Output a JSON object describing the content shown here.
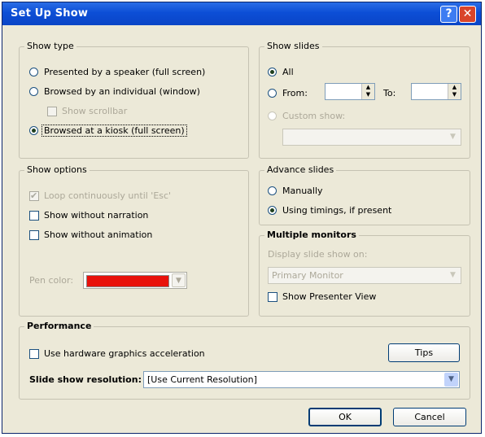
{
  "window": {
    "title": "Set Up Show",
    "help_glyph": "?",
    "close_glyph": "✕"
  },
  "show_type": {
    "title": "Show type",
    "options": [
      {
        "label": "Presented by a speaker (full screen)",
        "checked": false
      },
      {
        "label": "Browsed by an individual (window)",
        "checked": false
      },
      {
        "label": "Browsed at a kiosk (full screen)",
        "checked": true
      }
    ],
    "show_scrollbar_label": "Show scrollbar"
  },
  "show_slides": {
    "title": "Show slides",
    "all_label": "All",
    "from_label": "From:",
    "to_label": "To:",
    "custom_label": "Custom show:",
    "from_value": "",
    "to_value": ""
  },
  "show_options": {
    "title": "Show options",
    "loop_label": "Loop continuously until 'Esc'",
    "no_narration_label": "Show without narration",
    "no_animation_label": "Show without animation",
    "pen_color_label": "Pen color:",
    "pen_color": "#e8120c"
  },
  "advance_slides": {
    "title": "Advance slides",
    "manual_label": "Manually",
    "timings_label": "Using timings, if present"
  },
  "multiple_monitors": {
    "title": "Multiple monitors",
    "display_label": "Display slide show on:",
    "display_value": "Primary Monitor",
    "presenter_view_label": "Show Presenter View"
  },
  "performance": {
    "title": "Performance",
    "hw_accel_label": "Use hardware graphics acceleration",
    "tips_label": "Tips",
    "resolution_label": "Slide show resolution:",
    "resolution_value": "[Use Current Resolution]"
  },
  "footer": {
    "ok_label": "OK",
    "cancel_label": "Cancel"
  },
  "colors": {
    "titlebar": "#0c4ed6",
    "dialog_bg": "#ece9d8",
    "pen": "#e8120c"
  }
}
